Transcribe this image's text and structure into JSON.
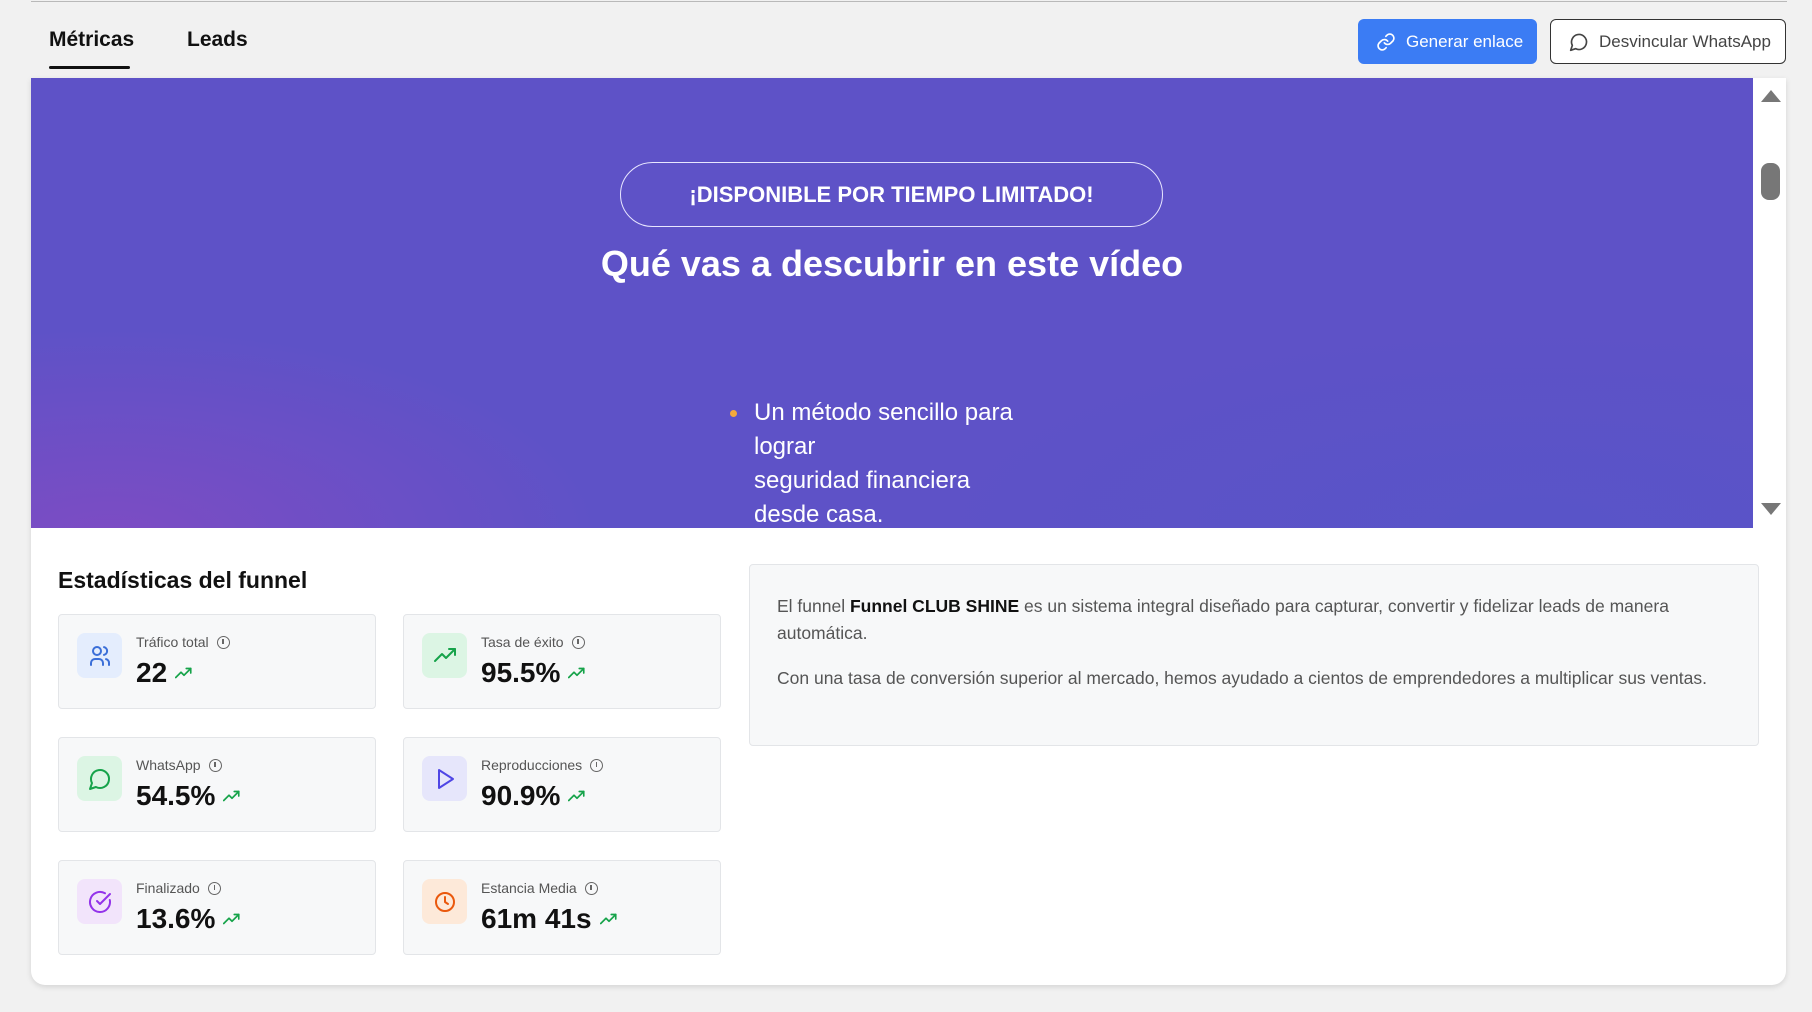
{
  "tabs": [
    {
      "label": "Métricas",
      "active": true
    },
    {
      "label": "Leads",
      "active": false
    }
  ],
  "header": {
    "generate_label": "Generar enlace",
    "generate_icon": "link-icon",
    "unlink_label": "Desvincular WhatsApp",
    "unlink_icon": "message-circle-icon",
    "accent_color": "#3b7cf4"
  },
  "preview": {
    "badge": "¡DISPONIBLE POR TIEMPO LIMITADO!",
    "title": "Qué vas a descubrir en este vídeo",
    "bullet_lines": [
      "Un método sencillo para",
      "lograr",
      "seguridad financiera",
      "desde casa."
    ],
    "background_color": "#5e52c7",
    "bullet_color": "#f4a93b"
  },
  "stats": {
    "title": "Estadísticas del funnel",
    "items": [
      {
        "label": "Tráfico total",
        "value": "22",
        "icon": "users-icon",
        "icon_color": "#3b6fd8",
        "icon_bg": "#e4edfd"
      },
      {
        "label": "Tasa de éxito",
        "value": "95.5%",
        "icon": "trending-up-icon",
        "icon_color": "#16a34a",
        "icon_bg": "#dcf5e4"
      },
      {
        "label": "WhatsApp",
        "value": "54.5%",
        "icon": "message-circle-icon",
        "icon_color": "#16a34a",
        "icon_bg": "#dcf5e4"
      },
      {
        "label": "Reproducciones",
        "value": "90.9%",
        "icon": "play-icon",
        "icon_color": "#4f46e5",
        "icon_bg": "#e6e6fb"
      },
      {
        "label": "Finalizado",
        "value": "13.6%",
        "icon": "check-circle-icon",
        "icon_color": "#9333ea",
        "icon_bg": "#f2e4fb"
      },
      {
        "label": "Estancia Media",
        "value": "61m 41s",
        "icon": "clock-icon",
        "icon_color": "#ea580c",
        "icon_bg": "#fde9d9"
      }
    ],
    "trend_color": "#16a34a"
  },
  "description": {
    "p1_prefix": "El funnel ",
    "p1_name": "Funnel CLUB SHINE",
    "p1_suffix": " es un sistema integral diseñado para capturar, convertir y fidelizar leads de manera automática.",
    "p2": "Con una tasa de conversión superior al mercado, hemos ayudado a cientos de emprendedores a multiplicar sus ventas."
  }
}
